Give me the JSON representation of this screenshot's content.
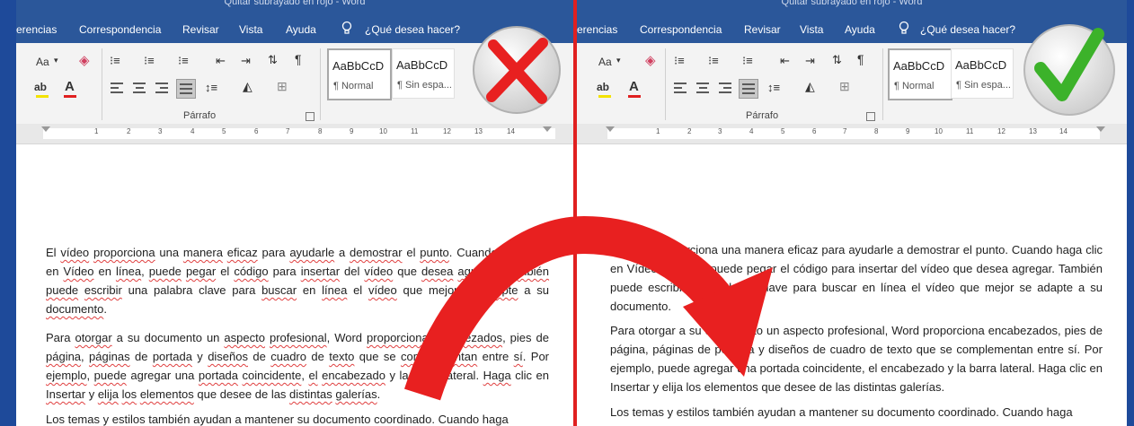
{
  "left_panel": {
    "title": "Quitar subrayado en rojo - Word",
    "tabs": [
      "erencias",
      "Correspondencia",
      "Revisar",
      "Vista",
      "Ayuda",
      "¿Qué desea hacer?"
    ],
    "font_size_label": "Aa",
    "group_label": "Párrafo",
    "styles": [
      {
        "preview": "AaBbCcD",
        "name": "¶ Normal"
      },
      {
        "preview": "AaBbCcD",
        "name": "¶ Sin espa..."
      }
    ],
    "ruler_numbers": [
      "1",
      "2",
      "3",
      "4",
      "5",
      "6",
      "7",
      "8",
      "9",
      "10",
      "11",
      "12",
      "13",
      "14"
    ],
    "paragraphs": [
      "El vídeo proporciona una manera eficaz para ayudarle a demostrar el punto. Cuando haga clic en Vídeo en línea, puede pegar el código para insertar del vídeo que desea agregar. También puede escribir una palabra clave para buscar en línea el vídeo que mejor se adapte a su documento.",
      "Para otorgar a su documento un aspecto profesional, Word proporciona encabezados, pies de página, páginas de portada y diseños de cuadro de texto que se complementan entre sí. Por ejemplo, puede agregar una portada coincidente, el encabezado y la barra lateral. Haga clic en Insertar y elija los elementos que desee de las distintas galerías.",
      "Los temas y estilos también ayudan a mantener su documento coordinado. Cuando haga"
    ]
  },
  "right_panel": {
    "title": "Quitar subrayado en rojo - Word",
    "tabs": [
      "erencias",
      "Correspondencia",
      "Revisar",
      "Vista",
      "Ayuda",
      "¿Qué desea hacer?"
    ],
    "font_size_label": "Aa",
    "group_label": "Párrafo",
    "styles": [
      {
        "preview": "AaBbCcD",
        "name": "¶ Normal"
      },
      {
        "preview": "AaBbCcD",
        "name": "¶ Sin espa..."
      }
    ],
    "ruler_numbers": [
      "1",
      "2",
      "3",
      "4",
      "5",
      "6",
      "7",
      "8",
      "9",
      "10",
      "11",
      "12",
      "13",
      "14"
    ],
    "paragraphs": [
      "El vídeo proporciona una manera eficaz para ayudarle a demostrar el punto. Cuando haga clic en Vídeo en línea, puede pegar el código para insertar del vídeo que desea agregar. También puede escribir una palabra clave para buscar en línea el vídeo que mejor se adapte a su documento.",
      "Para otorgar a su documento un aspecto profesional, Word proporciona encabezados, pies de página, páginas de portada y diseños de cuadro de texto que se complementan entre sí. Por ejemplo, puede agregar una portada coincidente, el encabezado y la barra lateral. Haga clic en Insertar y elija los elementos que desee de las distintas galerías.",
      "Los temas y estilos también ayudan a mantener su documento coordinado. Cuando haga"
    ]
  },
  "colors": {
    "ribbon_tabs_bg": "#2b579a",
    "spell_underline": "#e04040",
    "arrow": "#e82020",
    "wrong_badge": "#e82020",
    "correct_badge": "#3cb22a"
  },
  "icons": [
    "wrong-x-icon",
    "correct-check-icon",
    "curved-arrow-icon",
    "lightbulb-icon"
  ]
}
